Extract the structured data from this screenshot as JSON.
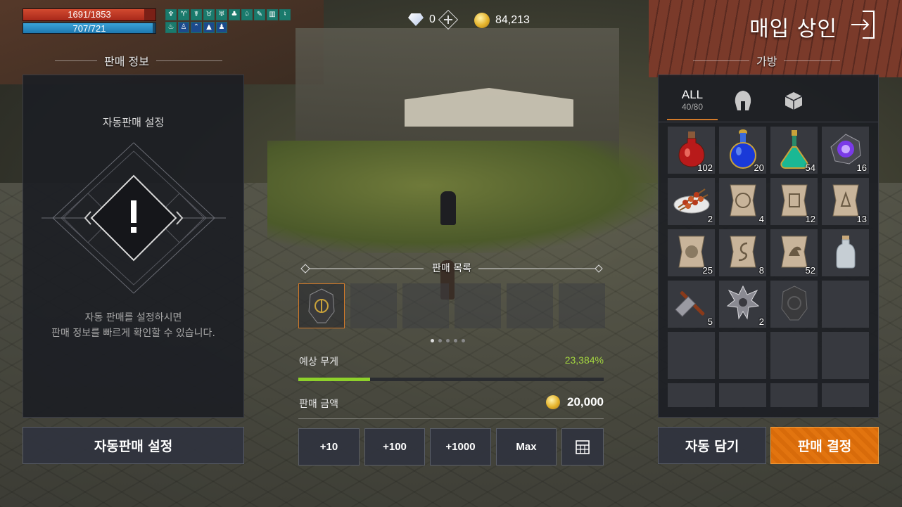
{
  "hud": {
    "hp_text": "1691/1853",
    "hp_fraction": 0.9126,
    "mp_text": "707/721",
    "mp_fraction": 0.9806
  },
  "currency": {
    "gems": "0",
    "gold": "84,213"
  },
  "header": {
    "title": "매입 상인"
  },
  "sale_info": {
    "section_label": "판매 정보",
    "title": "자동판매 설정",
    "desc_line1": "자동 판매를 설정하시면",
    "desc_line2": "판매 정보를 빠르게 확인할 수 있습니다.",
    "button_label": "자동판매 설정"
  },
  "sale_list": {
    "label": "판매 목록",
    "page_count": 5,
    "current_page": 1,
    "weight_label": "예상 무게",
    "weight_value": "23,384%",
    "weight_fraction": 0.235,
    "amount_label": "판매 금액",
    "amount_value": "20,000",
    "qty_buttons": [
      "+10",
      "+100",
      "+1000",
      "Max"
    ]
  },
  "bag": {
    "section_label": "가방",
    "tabs": [
      {
        "label": "ALL",
        "sub": "40/80",
        "active": true
      },
      {
        "icon": "helmet-icon"
      },
      {
        "icon": "box-icon"
      }
    ],
    "items": [
      {
        "icon": "red-potion-icon",
        "count": "102"
      },
      {
        "icon": "blue-potion-icon",
        "count": "20"
      },
      {
        "icon": "green-potion-icon",
        "count": "54"
      },
      {
        "icon": "purple-crystal-icon",
        "count": "16"
      },
      {
        "icon": "skewer-dish-icon",
        "count": "2"
      },
      {
        "icon": "scroll-icon",
        "count": "4"
      },
      {
        "icon": "scroll-icon",
        "count": "12"
      },
      {
        "icon": "scroll-icon",
        "count": "13"
      },
      {
        "icon": "scroll-icon",
        "count": "25"
      },
      {
        "icon": "scroll-icon",
        "count": "8"
      },
      {
        "icon": "scroll-icon",
        "count": "52"
      },
      {
        "icon": "empty-bottle-icon",
        "count": ""
      },
      {
        "icon": "hammer-icon",
        "count": "5"
      },
      {
        "icon": "spiked-badge-icon",
        "count": "2"
      },
      {
        "icon": "dark-stone-icon",
        "count": ""
      }
    ]
  },
  "actions": {
    "auto_fill": "자동 담기",
    "confirm_sale": "판매 결정"
  }
}
